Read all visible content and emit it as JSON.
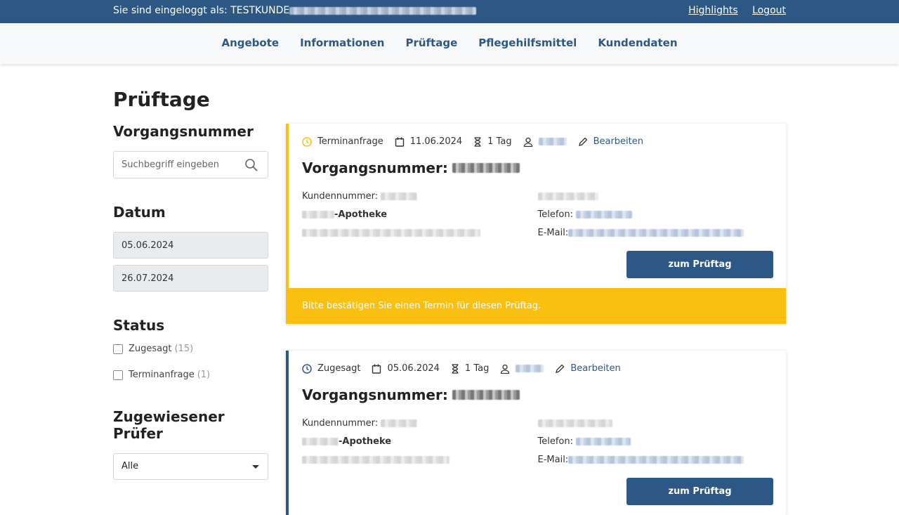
{
  "topbar": {
    "login_prefix": "Sie sind eingeloggt als:",
    "user": "TESTKUNDE",
    "links": [
      "Highlights",
      "Logout"
    ]
  },
  "nav": [
    "Angebote",
    "Informationen",
    "Prüftage",
    "Pflegehilfsmittel",
    "Kundendaten"
  ],
  "page_title": "Prüftage",
  "sidebar": {
    "vorgang_heading": "Vorgangsnummer",
    "search_placeholder": "Suchbegriff eingeben",
    "datum_heading": "Datum",
    "date_from": "05.06.2024",
    "date_to": "26.07.2024",
    "status_heading": "Status",
    "status_options": [
      {
        "label": "Zugesagt",
        "count": "(15)"
      },
      {
        "label": "Terminanfrage",
        "count": "(1)"
      }
    ],
    "pruefer_heading": "Zugewiesener Prüfer",
    "pruefer_selected": "Alle"
  },
  "cards": [
    {
      "status": "Terminanfrage",
      "date": "11.06.2024",
      "duration": "1 Tag",
      "edit_label": "Bearbeiten",
      "vn_label": "Vorgangsnummer:",
      "kundennummer_label": "Kundennummer:",
      "apotheke_suffix": "-Apotheke",
      "telefon_label": "Telefon:",
      "email_label": "E-Mail:",
      "button": "zum Prüftag",
      "notice": "Bitte bestätigen Sie einen Termin für diesen Prüftag."
    },
    {
      "status": "Zugesagt",
      "date": "05.06.2024",
      "duration": "1 Tag",
      "edit_label": "Bearbeiten",
      "vn_label": "Vorgangsnummer:",
      "kundennummer_label": "Kundennummer:",
      "apotheke_suffix": "-Apotheke",
      "telefon_label": "Telefon:",
      "email_label": "E-Mail:",
      "button": "zum Prüftag"
    }
  ],
  "colors": {
    "primary": "#2d5886",
    "warning": "#fbbf10"
  }
}
